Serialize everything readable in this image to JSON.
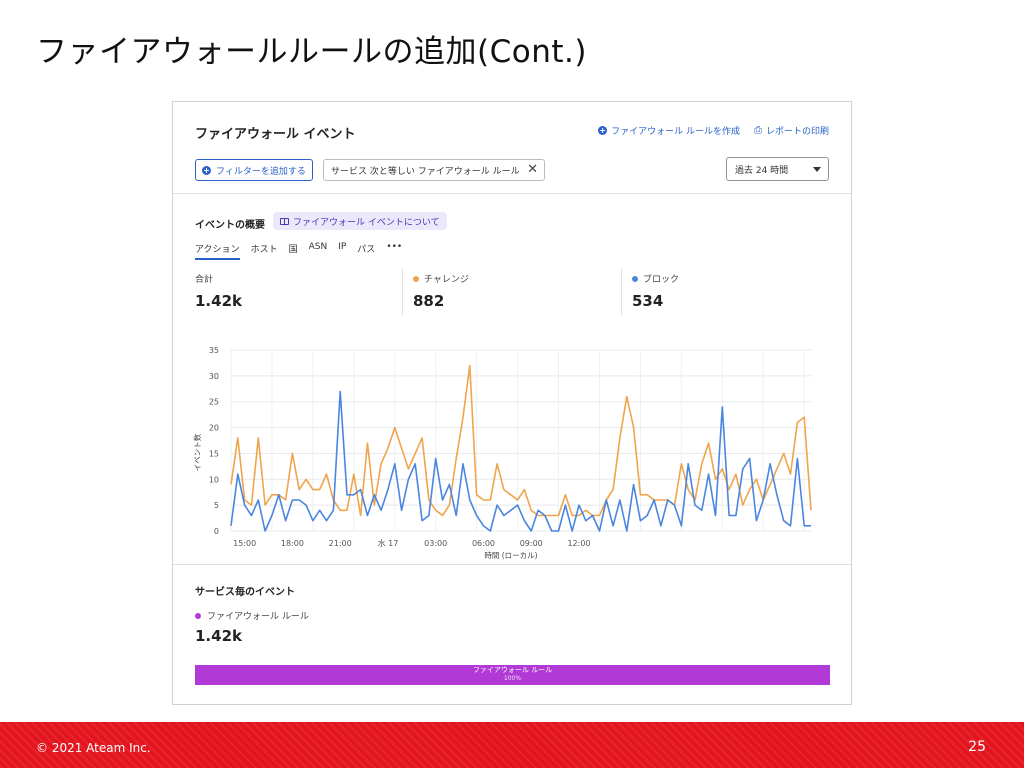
{
  "slide": {
    "title": "ファイアウォールルールの追加(Cont.)"
  },
  "header": {
    "title": "ファイアウォール イベント",
    "create_rule": "ファイアウォール ルールを作成",
    "print_report": "レポートの印刷",
    "add_filter": "フィルターを追加する",
    "filter_chip": "サービス 次と等しい ファイアウォール ルール",
    "time_range": "過去 24 時間"
  },
  "overview": {
    "title": "イベントの概要",
    "about_link": "ファイアウォール イベントについて",
    "tabs": [
      "アクション",
      "ホスト",
      "国",
      "ASN",
      "IP",
      "パス",
      "•••"
    ],
    "active_tab": 0,
    "stats": [
      {
        "label": "合計",
        "value": "1.42k",
        "color": ""
      },
      {
        "label": "チャレンジ",
        "value": "882",
        "color": "#f0a44b"
      },
      {
        "label": "ブロック",
        "value": "534",
        "color": "#4a86e0"
      }
    ]
  },
  "chart_data": {
    "type": "line",
    "ylabel": "イベント数",
    "xlabel": "時間 (ローカル)",
    "ylim": [
      0,
      35
    ],
    "yticks": [
      0,
      5,
      10,
      15,
      20,
      25,
      30,
      35
    ],
    "xtick_labels": [
      "15:00",
      "18:00",
      "21:00",
      "水 17",
      "03:00",
      "06:00",
      "09:00",
      "12:00"
    ],
    "grid": true,
    "series": [
      {
        "name": "チャレンジ",
        "color": "#f0a44b",
        "values": [
          9,
          18,
          6,
          5,
          18,
          5,
          7,
          7,
          6,
          15,
          8,
          10,
          8,
          8,
          11,
          6,
          4,
          4,
          11,
          3,
          17,
          5,
          13,
          16,
          20,
          16,
          12,
          15,
          18,
          6,
          4,
          3,
          5,
          14,
          22,
          32,
          7,
          6,
          6,
          13,
          8,
          7,
          6,
          8,
          4,
          3,
          3,
          3,
          3,
          7,
          3,
          3,
          4,
          3,
          3,
          6,
          8,
          18,
          26,
          20,
          7,
          7,
          6,
          6,
          6,
          5,
          13,
          8,
          6,
          13,
          17,
          10,
          12,
          8,
          11,
          5,
          8,
          10,
          6,
          9,
          12,
          15,
          11,
          21,
          22,
          4
        ]
      },
      {
        "name": "ブロック",
        "color": "#4a86e0",
        "values": [
          1,
          11,
          5,
          3,
          6,
          0,
          3,
          7,
          2,
          6,
          6,
          5,
          2,
          4,
          2,
          4,
          27,
          7,
          7,
          8,
          3,
          7,
          4,
          8,
          13,
          4,
          10,
          13,
          2,
          3,
          14,
          6,
          9,
          3,
          13,
          6,
          3,
          1,
          0,
          5,
          3,
          4,
          5,
          2,
          0,
          4,
          3,
          0,
          0,
          5,
          0,
          5,
          2,
          3,
          0,
          6,
          1,
          6,
          0,
          9,
          2,
          3,
          6,
          1,
          6,
          5,
          1,
          13,
          5,
          4,
          11,
          3,
          24,
          3,
          3,
          12,
          14,
          2,
          6,
          13,
          7,
          2,
          1,
          14,
          1,
          1
        ]
      }
    ]
  },
  "service_events": {
    "title": "サービス毎のイベント",
    "legend": "ファイアウォール ルール",
    "legend_color": "#b13ad6",
    "value": "1.42k",
    "bar_label": "ファイアウォール ルール",
    "bar_percent": "100%",
    "bar_fraction": 1.0
  },
  "footer": {
    "copyright": "© 2021 Ateam Inc.",
    "page": "25"
  }
}
